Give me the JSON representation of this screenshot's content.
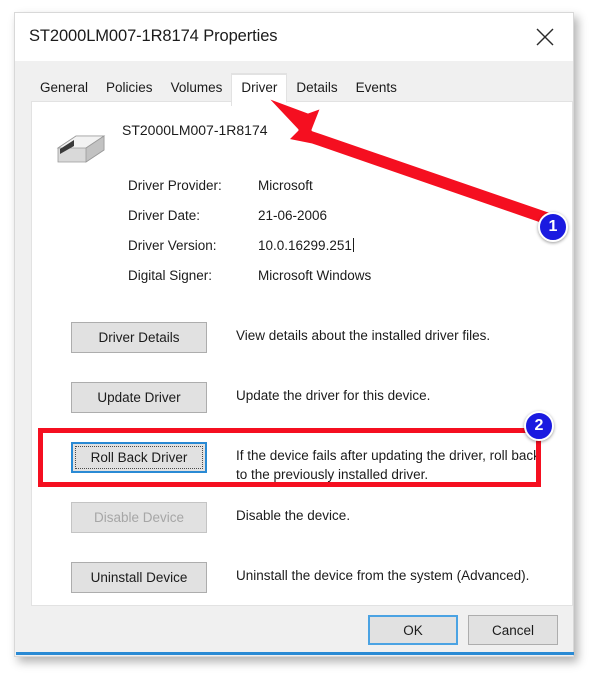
{
  "window": {
    "title": "ST2000LM007-1R8174 Properties",
    "close_icon": "close-icon"
  },
  "tabs": [
    {
      "label": "General",
      "selected": false
    },
    {
      "label": "Policies",
      "selected": false
    },
    {
      "label": "Volumes",
      "selected": false
    },
    {
      "label": "Driver",
      "selected": true
    },
    {
      "label": "Details",
      "selected": false
    },
    {
      "label": "Events",
      "selected": false
    }
  ],
  "device": {
    "icon": "hard-drive-icon",
    "name": "ST2000LM007-1R8174"
  },
  "driver_info": [
    {
      "label": "Driver Provider:",
      "value": "Microsoft"
    },
    {
      "label": "Driver Date:",
      "value": "21-06-2006"
    },
    {
      "label": "Driver Version:",
      "value": "10.0.16299.251"
    },
    {
      "label": "Digital Signer:",
      "value": "Microsoft Windows"
    }
  ],
  "actions": [
    {
      "label": "Driver Details",
      "description": "View details about the installed driver files.",
      "state": "enabled"
    },
    {
      "label": "Update Driver",
      "description": "Update the driver for this device.",
      "state": "enabled"
    },
    {
      "label": "Roll Back Driver",
      "description": "If the device fails after updating the driver, roll back to the previously installed driver.",
      "state": "focused"
    },
    {
      "label": "Disable Device",
      "description": "Disable the device.",
      "state": "disabled"
    },
    {
      "label": "Uninstall Device",
      "description": "Uninstall the device from the system (Advanced).",
      "state": "enabled"
    }
  ],
  "footer": {
    "ok_label": "OK",
    "cancel_label": "Cancel"
  },
  "annotations": {
    "badge_1": "1",
    "badge_2": "2",
    "arrow_color": "#f50f20",
    "badge_color": "#1a1ae0",
    "highlight_color": "#f50f20"
  }
}
